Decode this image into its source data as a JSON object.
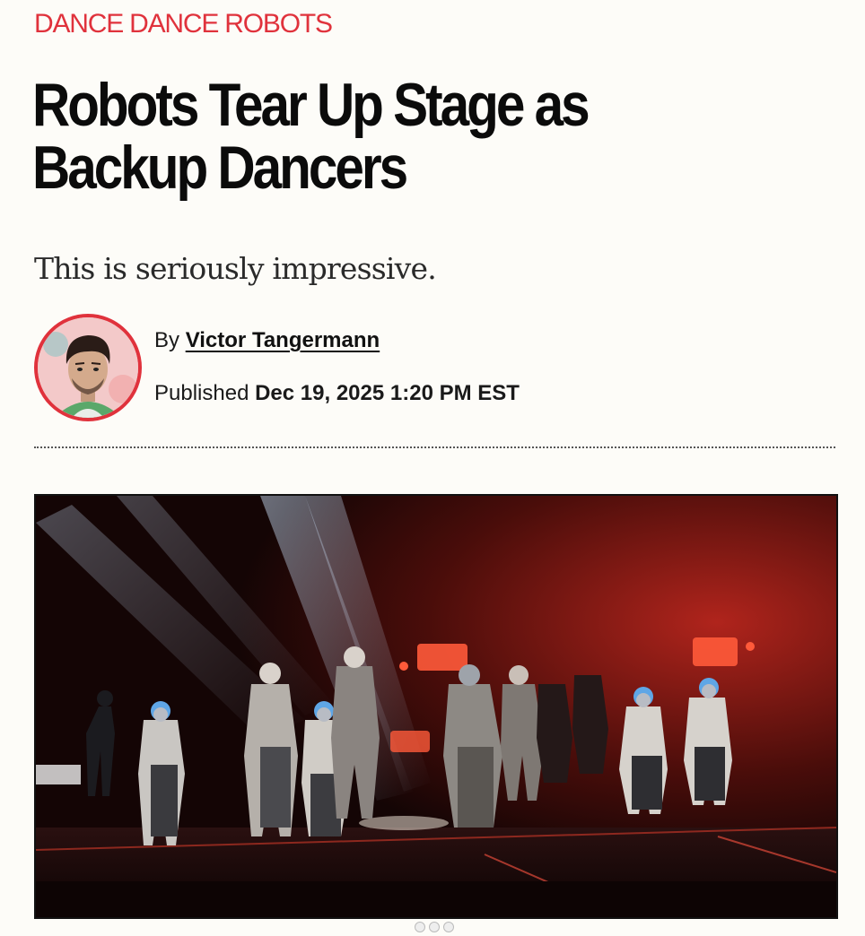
{
  "article": {
    "category": "DANCE DANCE ROBOTS",
    "headline": "Robots Tear Up Stage as Backup Dancers",
    "dek": "This is seriously impressive.",
    "byline": {
      "prefix": "By",
      "author": "Victor Tangermann"
    },
    "published": {
      "label": "Published",
      "date": "Dec 19, 2025 1:20 PM EST"
    }
  },
  "colors": {
    "accent": "#e0323c",
    "background": "#fdfcf8",
    "text": "#111111"
  },
  "media": {
    "image_subject": "concert-stage-robot-dancers",
    "carousel_pages": 3
  }
}
